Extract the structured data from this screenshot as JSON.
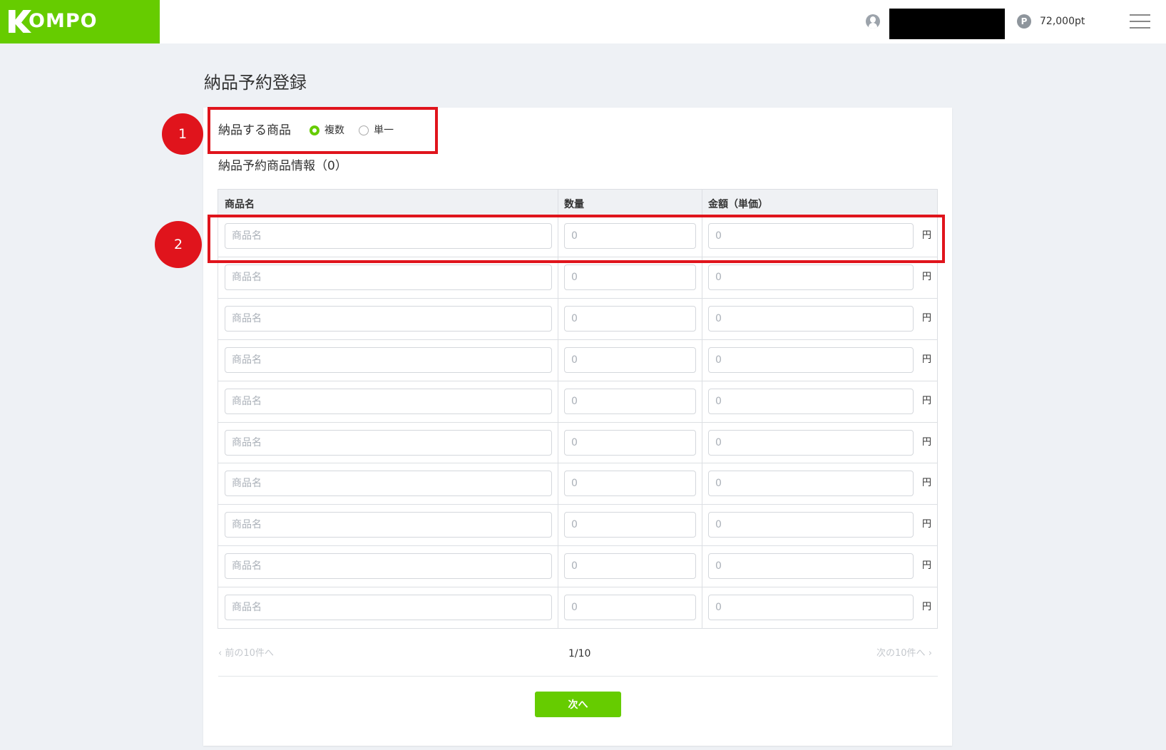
{
  "header": {
    "logo_text": "OMPO",
    "points": "72,000pt",
    "point_symbol": "P"
  },
  "page": {
    "title": "納品予約登録"
  },
  "form": {
    "product_type_label": "納品する商品",
    "options": [
      "複数",
      "単一"
    ],
    "selected": "複数",
    "section_title": "納品予約商品情報（0）"
  },
  "table": {
    "headers": [
      "商品名",
      "数量",
      "金額（単価）"
    ],
    "placeholders": {
      "name": "商品名",
      "quantity": "0",
      "price": "0"
    },
    "unit": "円",
    "rows": [
      {
        "name": "",
        "quantity": "",
        "price": ""
      },
      {
        "name": "",
        "quantity": "",
        "price": ""
      },
      {
        "name": "",
        "quantity": "",
        "price": ""
      },
      {
        "name": "",
        "quantity": "",
        "price": ""
      },
      {
        "name": "",
        "quantity": "",
        "price": ""
      },
      {
        "name": "",
        "quantity": "",
        "price": ""
      },
      {
        "name": "",
        "quantity": "",
        "price": ""
      },
      {
        "name": "",
        "quantity": "",
        "price": ""
      },
      {
        "name": "",
        "quantity": "",
        "price": ""
      },
      {
        "name": "",
        "quantity": "",
        "price": ""
      }
    ]
  },
  "pagination": {
    "prev": "前の10件へ",
    "page": "1/10",
    "next": "次の10件へ",
    "prev_arrow": "‹",
    "next_arrow": "›"
  },
  "actions": {
    "next": "次へ"
  },
  "annotations": [
    "1",
    "2"
  ],
  "colors": {
    "brand": "#66cc00",
    "annotation": "#e0141c",
    "background": "#eef1f5"
  }
}
